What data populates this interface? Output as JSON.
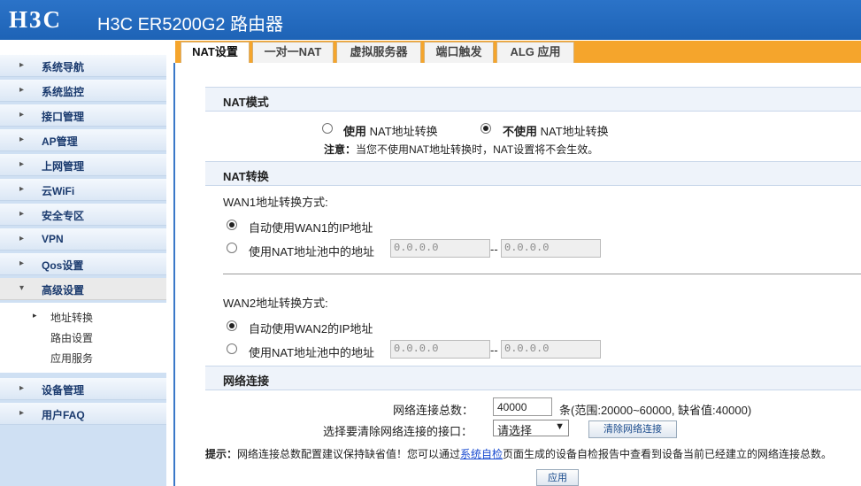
{
  "header": {
    "logo": "H3C",
    "title": "H3C ER5200G2 路由器"
  },
  "sidebar": {
    "items": [
      {
        "label": "系统导航"
      },
      {
        "label": "系统监控"
      },
      {
        "label": "接口管理"
      },
      {
        "label": "AP管理"
      },
      {
        "label": "上网管理"
      },
      {
        "label": "云WiFi"
      },
      {
        "label": "安全专区"
      },
      {
        "label": "VPN"
      },
      {
        "label": "Qos设置"
      },
      {
        "label": "高级设置"
      }
    ],
    "subitems": [
      {
        "label": "地址转换"
      },
      {
        "label": "路由设置"
      },
      {
        "label": "应用服务"
      }
    ],
    "items_after": [
      {
        "label": "设备管理"
      },
      {
        "label": "用户FAQ"
      }
    ]
  },
  "tabs": [
    {
      "label": "NAT设置"
    },
    {
      "label": "一对一NAT"
    },
    {
      "label": "虚拟服务器"
    },
    {
      "label": "端口触发"
    },
    {
      "label": "ALG 应用"
    }
  ],
  "nat_mode": {
    "title": "NAT模式",
    "use_bold": "使用",
    "use_text": "NAT地址转换",
    "nouse_bold": "不使用",
    "nouse_text": "NAT地址转换",
    "selected": "不使用",
    "note_label": "注意：",
    "note_text": "当您不使用NAT地址转换时，NAT设置将不会生效。"
  },
  "nat_convert": {
    "title": "NAT转换",
    "wan1": {
      "label": "WAN1地址转换方式:",
      "opt_auto": "自动使用WAN1的IP地址",
      "opt_pool": "使用NAT地址池中的地址",
      "selected": "auto",
      "start": "0.0.0.0",
      "sep": "--",
      "end": "0.0.0.0"
    },
    "wan2": {
      "label": "WAN2地址转换方式:",
      "opt_auto": "自动使用WAN2的IP地址",
      "opt_pool": "使用NAT地址池中的地址",
      "selected": "auto",
      "start": "0.0.0.0",
      "sep": "--",
      "end": "0.0.0.0"
    }
  },
  "connections": {
    "title": "网络连接",
    "total_label": "网络连接总数：",
    "total_value": "40000",
    "range_text": "条(范围:20000~60000, 缺省值:40000)",
    "clear_label": "选择要清除网络连接的接口：",
    "clear_select": "请选择",
    "clear_button": "清除网络连接",
    "tip_label": "提示：",
    "tip_before": "网络连接总数配置建议保持缺省值！您可以通过",
    "tip_link": "系统自检",
    "tip_after": "页面生成的设备自检报告中查看到设备当前已经建立的网络连接总数。"
  },
  "apply_button": "应用"
}
